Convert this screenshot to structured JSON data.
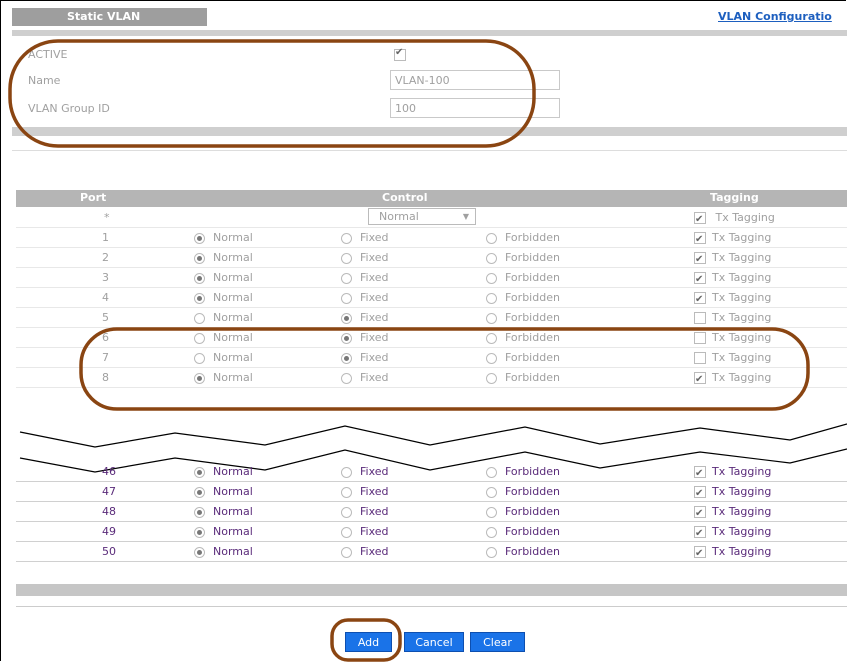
{
  "header": {
    "tab_title": "Static VLAN",
    "link_label": "VLAN Configuratio"
  },
  "form": {
    "active_label": "ACTIVE",
    "active_checked": true,
    "name_label": "Name",
    "name_value": "VLAN-100",
    "group_label": "VLAN Group ID",
    "group_value": "100"
  },
  "table": {
    "headers": {
      "port": "Port",
      "control": "Control",
      "tagging": "Tagging"
    },
    "all_row": {
      "port": "*",
      "control_select": "Normal",
      "tagging": "Tx Tagging",
      "tag_checked": true
    },
    "options": {
      "normal": "Normal",
      "fixed": "Fixed",
      "forbidden": "Forbidden",
      "tagging": "Tx Tagging"
    },
    "upper_rows": [
      {
        "port": "1",
        "control": "normal",
        "tag": true
      },
      {
        "port": "2",
        "control": "normal",
        "tag": true
      },
      {
        "port": "3",
        "control": "normal",
        "tag": true
      },
      {
        "port": "4",
        "control": "normal",
        "tag": true
      },
      {
        "port": "5",
        "control": "fixed",
        "tag": false
      },
      {
        "port": "6",
        "control": "fixed",
        "tag": false
      },
      {
        "port": "7",
        "control": "fixed",
        "tag": false
      },
      {
        "port": "8",
        "control": "normal",
        "tag": true
      }
    ],
    "lower_rows": [
      {
        "port": "46",
        "control": "normal",
        "tag": true
      },
      {
        "port": "47",
        "control": "normal",
        "tag": true
      },
      {
        "port": "48",
        "control": "normal",
        "tag": true
      },
      {
        "port": "49",
        "control": "normal",
        "tag": true
      },
      {
        "port": "50",
        "control": "normal",
        "tag": true
      }
    ]
  },
  "buttons": {
    "add": "Add",
    "cancel": "Cancel",
    "clear": "Clear"
  },
  "colors": {
    "highlight_ring": "#8a4512",
    "button_blue": "#1a73e8",
    "header_gray": "#b5b5b5"
  }
}
